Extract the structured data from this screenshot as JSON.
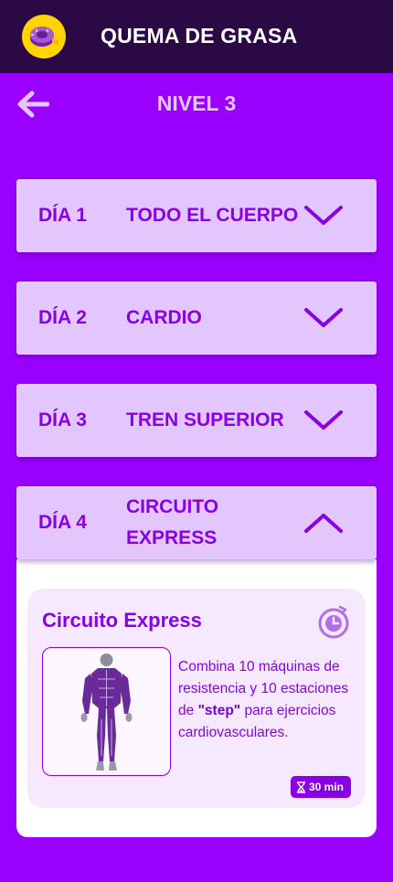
{
  "header": {
    "title": "QUEMA DE GRASA",
    "logo_icon": "tape-measure-icon"
  },
  "nav": {
    "back_icon": "arrow-left-icon",
    "level_title": "NIVEL 3"
  },
  "days": [
    {
      "label": "DÍA 1",
      "title": "TODO EL CUERPO",
      "expanded": false
    },
    {
      "label": "DÍA 2",
      "title": "CARDIO",
      "expanded": false
    },
    {
      "label": "DÍA 3",
      "title": "TREN SUPERIOR",
      "expanded": false
    },
    {
      "label": "DÍA 4",
      "title": "CIRCUITO EXPRESS",
      "expanded": true
    }
  ],
  "workout": {
    "title": "Circuito Express",
    "desc_before": "Combina 10 máquinas de resistencia y 10 estaciones de ",
    "desc_highlight": "\"step\"",
    "desc_after": " para ejercicios cardiovasculares.",
    "duration": "30 min",
    "icons": {
      "timer": "timer-icon",
      "hourglass": "hourglass-icon",
      "figure": "muscle-body-icon"
    }
  },
  "colors": {
    "background": "#9a00ff",
    "topbar": "#2a0944",
    "card": "#e4c6ff",
    "accent": "#8a00e6",
    "logo": "#ffd400"
  }
}
